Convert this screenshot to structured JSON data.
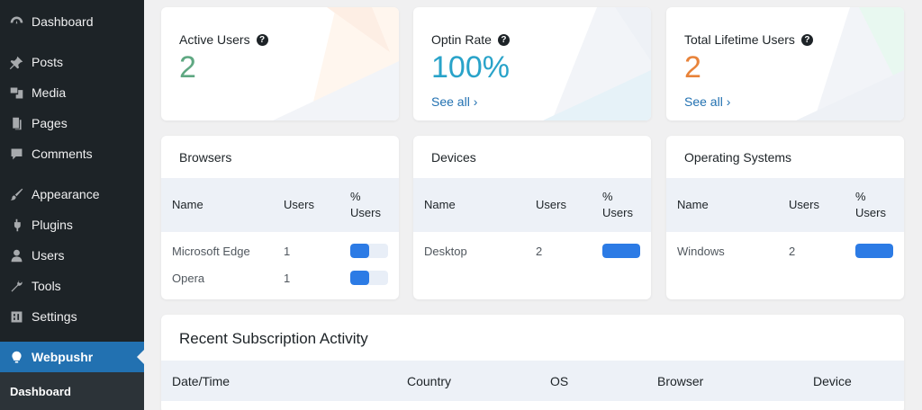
{
  "sidebar": {
    "items": [
      {
        "label": "Dashboard",
        "icon": "dashboard-icon"
      },
      {
        "label": "Posts",
        "icon": "pin-icon"
      },
      {
        "label": "Media",
        "icon": "media-icon"
      },
      {
        "label": "Pages",
        "icon": "pages-icon"
      },
      {
        "label": "Comments",
        "icon": "comments-icon"
      },
      {
        "label": "Appearance",
        "icon": "brush-icon"
      },
      {
        "label": "Plugins",
        "icon": "plugin-icon"
      },
      {
        "label": "Users",
        "icon": "users-icon"
      },
      {
        "label": "Tools",
        "icon": "wrench-icon"
      },
      {
        "label": "Settings",
        "icon": "settings-icon"
      },
      {
        "label": "Webpushr",
        "icon": "webpushr-icon",
        "active": true
      }
    ],
    "submenu": {
      "label": "Dashboard"
    }
  },
  "stats": [
    {
      "title": "Active Users",
      "value": "2",
      "color": "#5fa882",
      "see_all": ""
    },
    {
      "title": "Optin Rate",
      "value": "100%",
      "color": "#29a3c9",
      "see_all": "See all"
    },
    {
      "title": "Total Lifetime Users",
      "value": "2",
      "color": "#e8833a",
      "see_all": "See all"
    }
  ],
  "tables": [
    {
      "title": "Browsers",
      "headers": {
        "name": "Name",
        "users": "Users",
        "pct1": "%",
        "pct2": "Users"
      },
      "rows": [
        {
          "name": "Microsoft Edge",
          "users": "1",
          "pct": 0.5
        },
        {
          "name": "Opera",
          "users": "1",
          "pct": 0.5
        }
      ]
    },
    {
      "title": "Devices",
      "headers": {
        "name": "Name",
        "users": "Users",
        "pct1": "%",
        "pct2": "Users"
      },
      "rows": [
        {
          "name": "Desktop",
          "users": "2",
          "pct": 1.0
        }
      ]
    },
    {
      "title": "Operating Systems",
      "headers": {
        "name": "Name",
        "users": "Users",
        "pct1": "%",
        "pct2": "Users"
      },
      "rows": [
        {
          "name": "Windows",
          "users": "2",
          "pct": 1.0
        }
      ]
    }
  ],
  "recent": {
    "title": "Recent Subscription Activity",
    "columns": [
      "Date/Time",
      "Country",
      "OS",
      "Browser",
      "Device"
    ]
  },
  "colors": {
    "accent": "#2271b1",
    "bar": "#2c7be5"
  }
}
